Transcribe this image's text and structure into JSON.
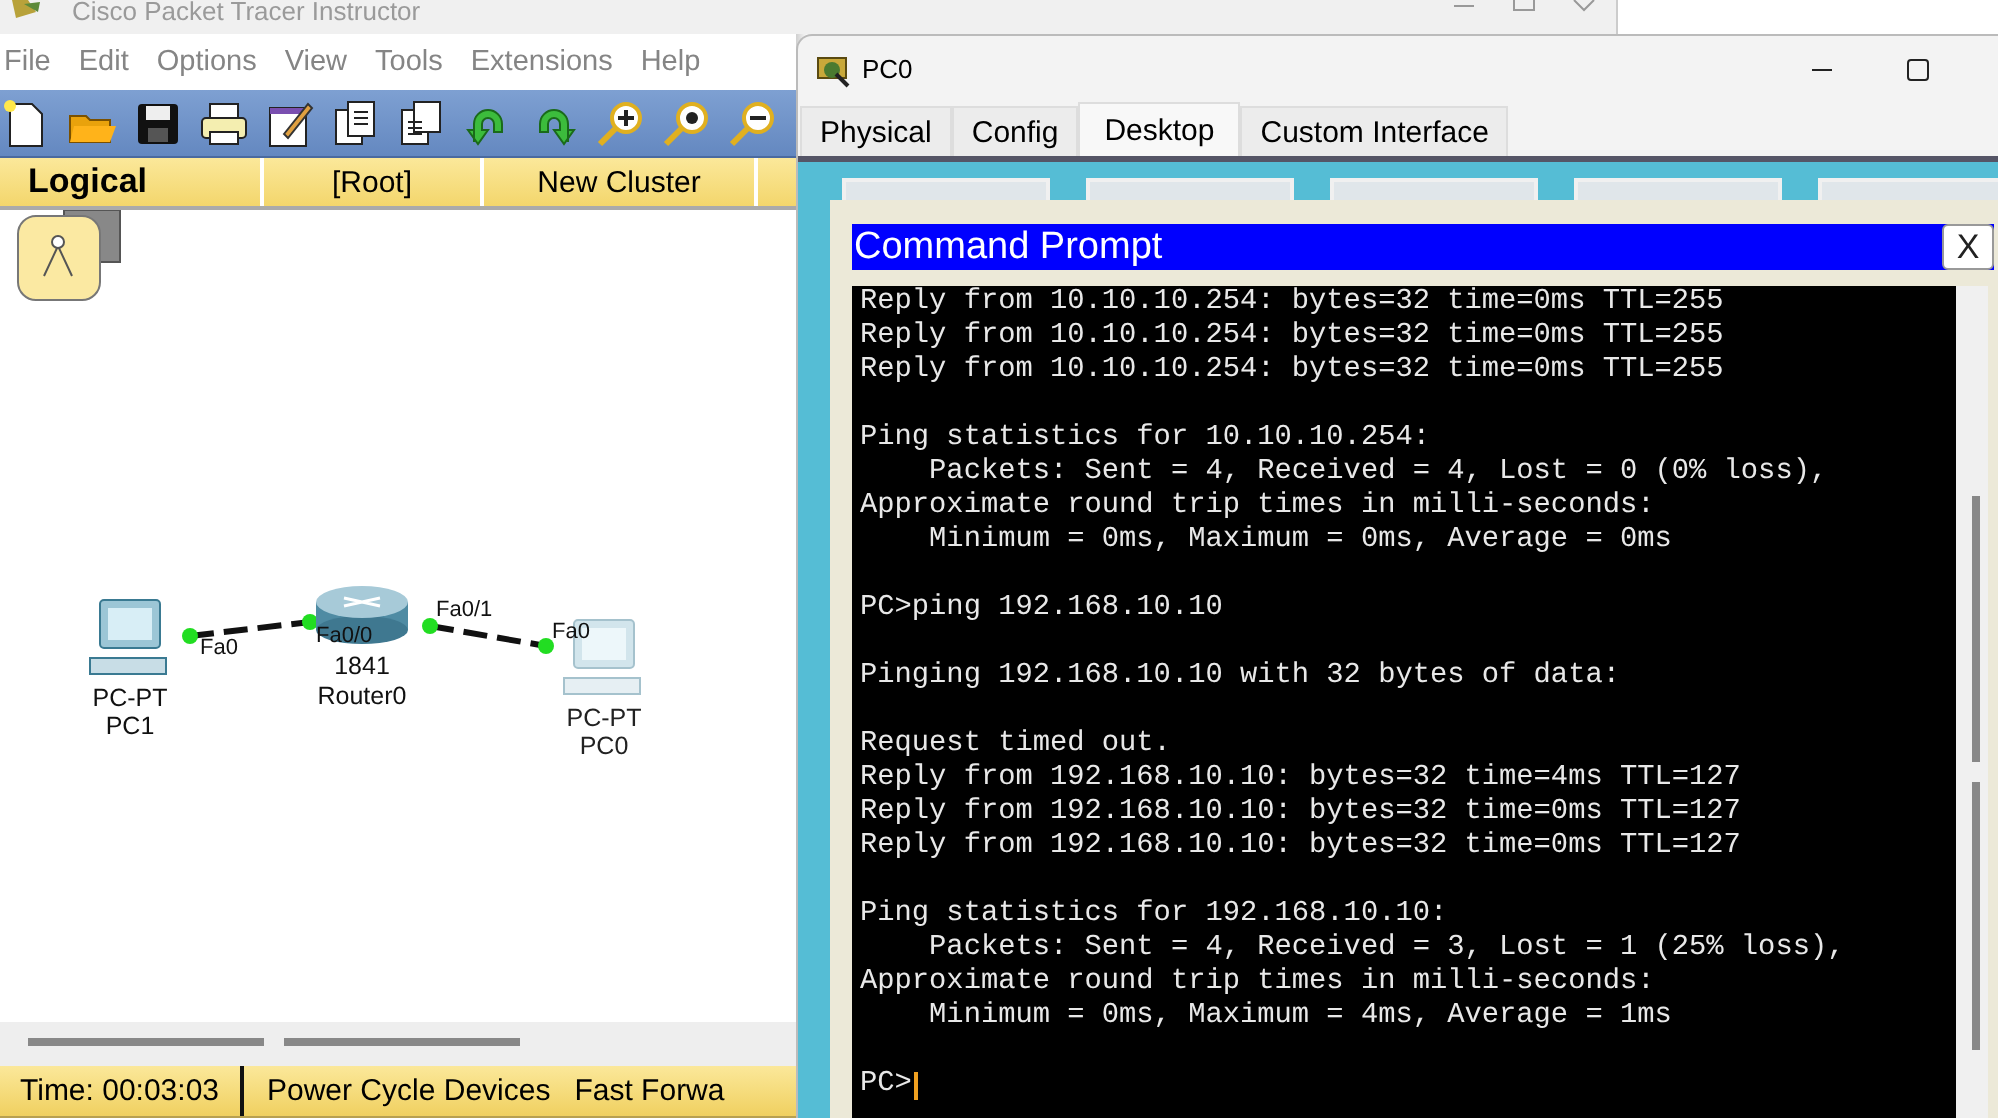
{
  "main_window": {
    "title": "Cisco Packet Tracer Instructor",
    "menu": [
      "File",
      "Edit",
      "Options",
      "View",
      "Tools",
      "Extensions",
      "Help"
    ],
    "workspace_bar": {
      "mode": "Logical",
      "path": "[Root]",
      "cluster": "New Cluster"
    },
    "devices": [
      {
        "kind": "pc",
        "model": "PC-PT",
        "name": "PC1",
        "dimmed": false
      },
      {
        "kind": "router",
        "model": "1841",
        "name": "Router0",
        "dimmed": false
      },
      {
        "kind": "pc",
        "model": "PC-PT",
        "name": "PC0",
        "dimmed": true
      }
    ],
    "links": [
      {
        "from_port": "Fa0",
        "to_port": "Fa0/0"
      },
      {
        "from_port": "Fa0/1",
        "to_port": "Fa0"
      }
    ],
    "status_bar": {
      "time": "Time: 00:03:03",
      "buttons": [
        "Power Cycle Devices",
        "Fast Forwa"
      ]
    }
  },
  "device_window": {
    "title": "PC0",
    "tabs": [
      {
        "label": "Physical",
        "selected": false
      },
      {
        "label": "Config",
        "selected": false
      },
      {
        "label": "Desktop",
        "selected": true
      },
      {
        "label": "Custom Interface",
        "selected": false
      }
    ],
    "command_prompt": {
      "title": "Command Prompt",
      "close": "X",
      "blocks": [
        [
          "Reply from 10.10.10.254: bytes=32 time=0ms TTL=255",
          "Reply from 10.10.10.254: bytes=32 time=0ms TTL=255",
          "Reply from 10.10.10.254: bytes=32 time=0ms TTL=255"
        ],
        [
          "Ping statistics for 10.10.10.254:",
          "    Packets: Sent = 4, Received = 4, Lost = 0 (0% loss),",
          "Approximate round trip times in milli-seconds:",
          "    Minimum = 0ms, Maximum = 0ms, Average = 0ms"
        ],
        [
          "PC>ping 192.168.10.10"
        ],
        [
          "Pinging 192.168.10.10 with 32 bytes of data:"
        ],
        [
          "Request timed out.",
          "Reply from 192.168.10.10: bytes=32 time=4ms TTL=127",
          "Reply from 192.168.10.10: bytes=32 time=0ms TTL=127",
          "Reply from 192.168.10.10: bytes=32 time=0ms TTL=127"
        ],
        [
          "Ping statistics for 192.168.10.10:",
          "    Packets: Sent = 4, Received = 3, Lost = 1 (25% loss),",
          "Approximate round trip times in milli-seconds:",
          "    Minimum = 0ms, Maximum = 4ms, Average = 1ms"
        ],
        [
          "PC>"
        ]
      ]
    }
  }
}
